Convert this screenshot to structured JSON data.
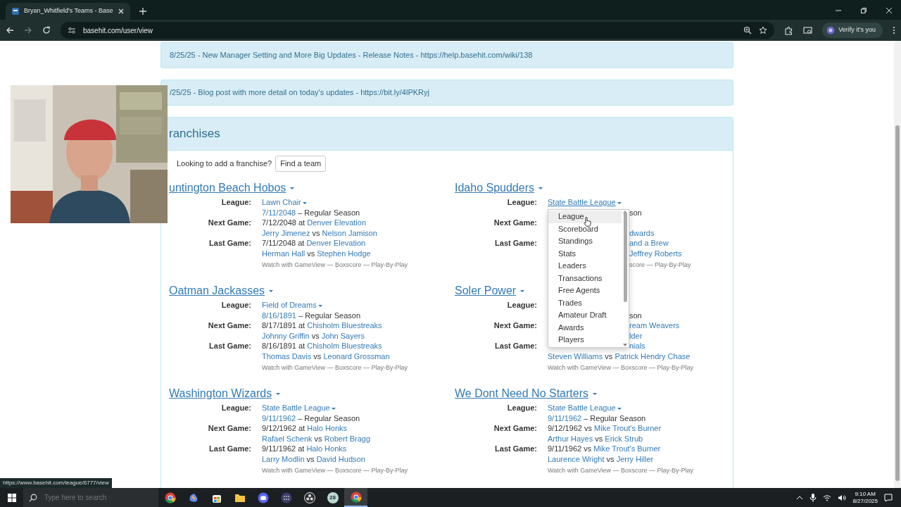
{
  "browser": {
    "tab_title": "Bryan_Whitfield's Teams - Base",
    "url": "basehit.com/user/view",
    "profile_label": "Verify it's you",
    "forward_disabled": true
  },
  "announcements": [
    "8/25/25 - New Manager Setting and More Big Updates - Release Notes - https://help.basehit.com/wiki/138",
    "/25/25 - Blog post with more detail on today's updates - https://bit.ly/4lPKRyj"
  ],
  "franchises": {
    "title": "ranchises",
    "prompt": "Looking to add a franchise?",
    "button": "Find a team",
    "teams": [
      {
        "name": "untington Beach Hobos",
        "rows": [
          {
            "label": "League:",
            "kind": "line",
            "parts": [
              {
                "kind": "dropdown",
                "text": "Lawn Chair",
                "hovered": false
              }
            ]
          },
          {
            "kind": "line",
            "parts": [
              {
                "kind": "link",
                "text": "7/11/2048"
              },
              {
                "kind": "text",
                "text": " – Regular Season"
              }
            ]
          },
          {
            "label": "Next Game:",
            "kind": "line",
            "parts": [
              {
                "kind": "text",
                "text": "7/12/2048 at "
              },
              {
                "kind": "link",
                "text": "Denver Elevation"
              }
            ]
          },
          {
            "kind": "line",
            "parts": [
              {
                "kind": "link",
                "text": "Jerry Jimenez"
              },
              {
                "kind": "text",
                "text": " vs "
              },
              {
                "kind": "link",
                "text": "Nelson Jamison"
              }
            ]
          },
          {
            "label": "Last Game:",
            "kind": "line",
            "parts": [
              {
                "kind": "text",
                "text": "7/11/2048 at "
              },
              {
                "kind": "link",
                "text": "Denver Elevation"
              }
            ]
          },
          {
            "kind": "line",
            "parts": [
              {
                "kind": "link",
                "text": "Herman Hall"
              },
              {
                "kind": "text",
                "text": " vs "
              },
              {
                "kind": "link",
                "text": "Stephen Hodge"
              }
            ]
          },
          {
            "kind": "small",
            "parts": [
              {
                "kind": "text",
                "text": "Watch with GameView — Boxscore — Play-By-Play"
              }
            ]
          }
        ]
      },
      {
        "name": "Idaho Spudders",
        "menu": {
          "items": [
            {
              "label": "League",
              "hovered": true
            },
            {
              "label": "Scoreboard",
              "hovered": false
            },
            {
              "label": "Standings",
              "hovered": false
            },
            {
              "label": "Stats",
              "hovered": false
            },
            {
              "label": "Leaders",
              "hovered": false
            },
            {
              "label": "Transactions",
              "hovered": false
            },
            {
              "label": "Free Agents",
              "hovered": false
            },
            {
              "label": "Trades",
              "hovered": false
            },
            {
              "label": "Amateur Draft",
              "hovered": false
            },
            {
              "label": "Awards",
              "hovered": false
            },
            {
              "label": "Players",
              "hovered": false
            }
          ]
        },
        "rows": [
          {
            "label": "League:",
            "kind": "line",
            "parts": [
              {
                "kind": "dropdown",
                "text": "State Battle League",
                "hovered": true
              }
            ]
          },
          {
            "kind": "covered",
            "parts": [
              {
                "kind": "text",
                "text": "son"
              }
            ]
          },
          {
            "label": "Next Game:",
            "kind": "covered",
            "parts": []
          },
          {
            "kind": "covered",
            "parts": [
              {
                "kind": "link",
                "text": "dwards"
              }
            ]
          },
          {
            "label": "Last Game:",
            "kind": "covered",
            "parts": [
              {
                "kind": "link",
                "text": "and a Brew"
              }
            ]
          },
          {
            "kind": "covered",
            "parts": [
              {
                "kind": "link",
                "text": "Jeffrey Roberts"
              }
            ]
          },
          {
            "kind": "covered-small",
            "parts": [
              {
                "kind": "text",
                "text": "score — Play-By-Play"
              }
            ]
          }
        ]
      },
      {
        "name": "Oatman Jackasses",
        "rows": [
          {
            "label": "League:",
            "kind": "line",
            "parts": [
              {
                "kind": "dropdown",
                "text": "Field of Dreams",
                "hovered": false
              }
            ]
          },
          {
            "kind": "line",
            "parts": [
              {
                "kind": "link",
                "text": "8/16/1891"
              },
              {
                "kind": "text",
                "text": " – Regular Season"
              }
            ]
          },
          {
            "label": "Next Game:",
            "kind": "line",
            "parts": [
              {
                "kind": "text",
                "text": "8/17/1891 at "
              },
              {
                "kind": "link",
                "text": "Chisholm Bluestreaks"
              }
            ]
          },
          {
            "kind": "line",
            "parts": [
              {
                "kind": "link",
                "text": "Johnny Griffin"
              },
              {
                "kind": "text",
                "text": " vs "
              },
              {
                "kind": "link",
                "text": "John Sayers"
              }
            ]
          },
          {
            "label": "Last Game:",
            "kind": "line",
            "parts": [
              {
                "kind": "text",
                "text": "8/16/1891 at "
              },
              {
                "kind": "link",
                "text": "Chisholm Bluestreaks"
              }
            ]
          },
          {
            "kind": "line",
            "parts": [
              {
                "kind": "link",
                "text": "Thomas Davis"
              },
              {
                "kind": "text",
                "text": " vs "
              },
              {
                "kind": "link",
                "text": "Leonard Grossman"
              }
            ]
          },
          {
            "kind": "small",
            "parts": [
              {
                "kind": "text",
                "text": "Watch with GameView — Boxscore — Play-By-Play"
              }
            ]
          }
        ]
      },
      {
        "name": "Soler Power",
        "rows": [
          {
            "label": "League:",
            "kind": "covered",
            "parts": []
          },
          {
            "kind": "covered",
            "parts": [
              {
                "kind": "text",
                "text": "son"
              }
            ]
          },
          {
            "label": "Next Game:",
            "kind": "covered",
            "parts": [
              {
                "kind": "link",
                "text": "ream Weavers"
              }
            ]
          },
          {
            "kind": "covered",
            "parts": [
              {
                "kind": "link",
                "text": "lder"
              }
            ]
          },
          {
            "label": "Last Game:",
            "kind": "covered",
            "parts": [
              {
                "kind": "link",
                "text": "nials"
              }
            ]
          },
          {
            "kind": "line",
            "parts": [
              {
                "kind": "link",
                "text": "Steven Williams"
              },
              {
                "kind": "text",
                "text": " vs "
              },
              {
                "kind": "link",
                "text": "Patrick Hendry Chase"
              }
            ]
          },
          {
            "kind": "small",
            "parts": [
              {
                "kind": "text",
                "text": "Watch with GameView — Boxscore — Play-By-Play"
              }
            ]
          }
        ]
      },
      {
        "name": "Washington Wizards",
        "rows": [
          {
            "label": "League:",
            "kind": "line",
            "parts": [
              {
                "kind": "dropdown",
                "text": "State Battle League",
                "hovered": false
              }
            ]
          },
          {
            "kind": "line",
            "parts": [
              {
                "kind": "link",
                "text": "9/11/1962"
              },
              {
                "kind": "text",
                "text": " – Regular Season"
              }
            ]
          },
          {
            "label": "Next Game:",
            "kind": "line",
            "parts": [
              {
                "kind": "text",
                "text": "9/12/1962 at "
              },
              {
                "kind": "link",
                "text": "Halo Honks"
              }
            ]
          },
          {
            "kind": "line",
            "parts": [
              {
                "kind": "link",
                "text": "Rafael Schenk"
              },
              {
                "kind": "text",
                "text": " vs "
              },
              {
                "kind": "link",
                "text": "Robert Bragg"
              }
            ]
          },
          {
            "label": "Last Game:",
            "kind": "line",
            "parts": [
              {
                "kind": "text",
                "text": "9/11/1962 at "
              },
              {
                "kind": "link",
                "text": "Halo Honks"
              }
            ]
          },
          {
            "kind": "line",
            "parts": [
              {
                "kind": "link",
                "text": "Larry Modlin"
              },
              {
                "kind": "text",
                "text": " vs "
              },
              {
                "kind": "link",
                "text": "David Hudson"
              }
            ]
          },
          {
            "kind": "small",
            "parts": [
              {
                "kind": "text",
                "text": "Watch with GameView — Boxscore — Play-By-Play"
              }
            ]
          }
        ]
      },
      {
        "name": "We Dont Need No Starters",
        "rows": [
          {
            "label": "League:",
            "kind": "line",
            "parts": [
              {
                "kind": "dropdown",
                "text": "State Battle League",
                "hovered": false
              }
            ]
          },
          {
            "kind": "line",
            "parts": [
              {
                "kind": "link",
                "text": "9/11/1962"
              },
              {
                "kind": "text",
                "text": " – Regular Season"
              }
            ]
          },
          {
            "label": "Next Game:",
            "kind": "line",
            "parts": [
              {
                "kind": "text",
                "text": "9/12/1962 vs "
              },
              {
                "kind": "link",
                "text": "Mike Trout's Burner"
              }
            ]
          },
          {
            "kind": "line",
            "parts": [
              {
                "kind": "link",
                "text": "Arthur Hayes"
              },
              {
                "kind": "text",
                "text": " vs "
              },
              {
                "kind": "link",
                "text": "Erick Strub"
              }
            ]
          },
          {
            "label": "Last Game:",
            "kind": "line",
            "parts": [
              {
                "kind": "text",
                "text": "9/11/1962 vs "
              },
              {
                "kind": "link",
                "text": "Mike Trout's Burner"
              }
            ]
          },
          {
            "kind": "line",
            "parts": [
              {
                "kind": "link",
                "text": "Laurence Wright"
              },
              {
                "kind": "text",
                "text": " vs "
              },
              {
                "kind": "link",
                "text": "Jerry Hiller"
              }
            ]
          },
          {
            "kind": "small",
            "parts": [
              {
                "kind": "text",
                "text": "Watch with GameView — Boxscore — Play-By-Play"
              }
            ]
          }
        ]
      }
    ]
  },
  "status_url": "https://www.basehit.com/league/6777/view",
  "taskbar": {
    "search_placeholder": "Type here to search",
    "app_badge": "28",
    "time": "9:10 AM",
    "date": "8/27/2025"
  }
}
